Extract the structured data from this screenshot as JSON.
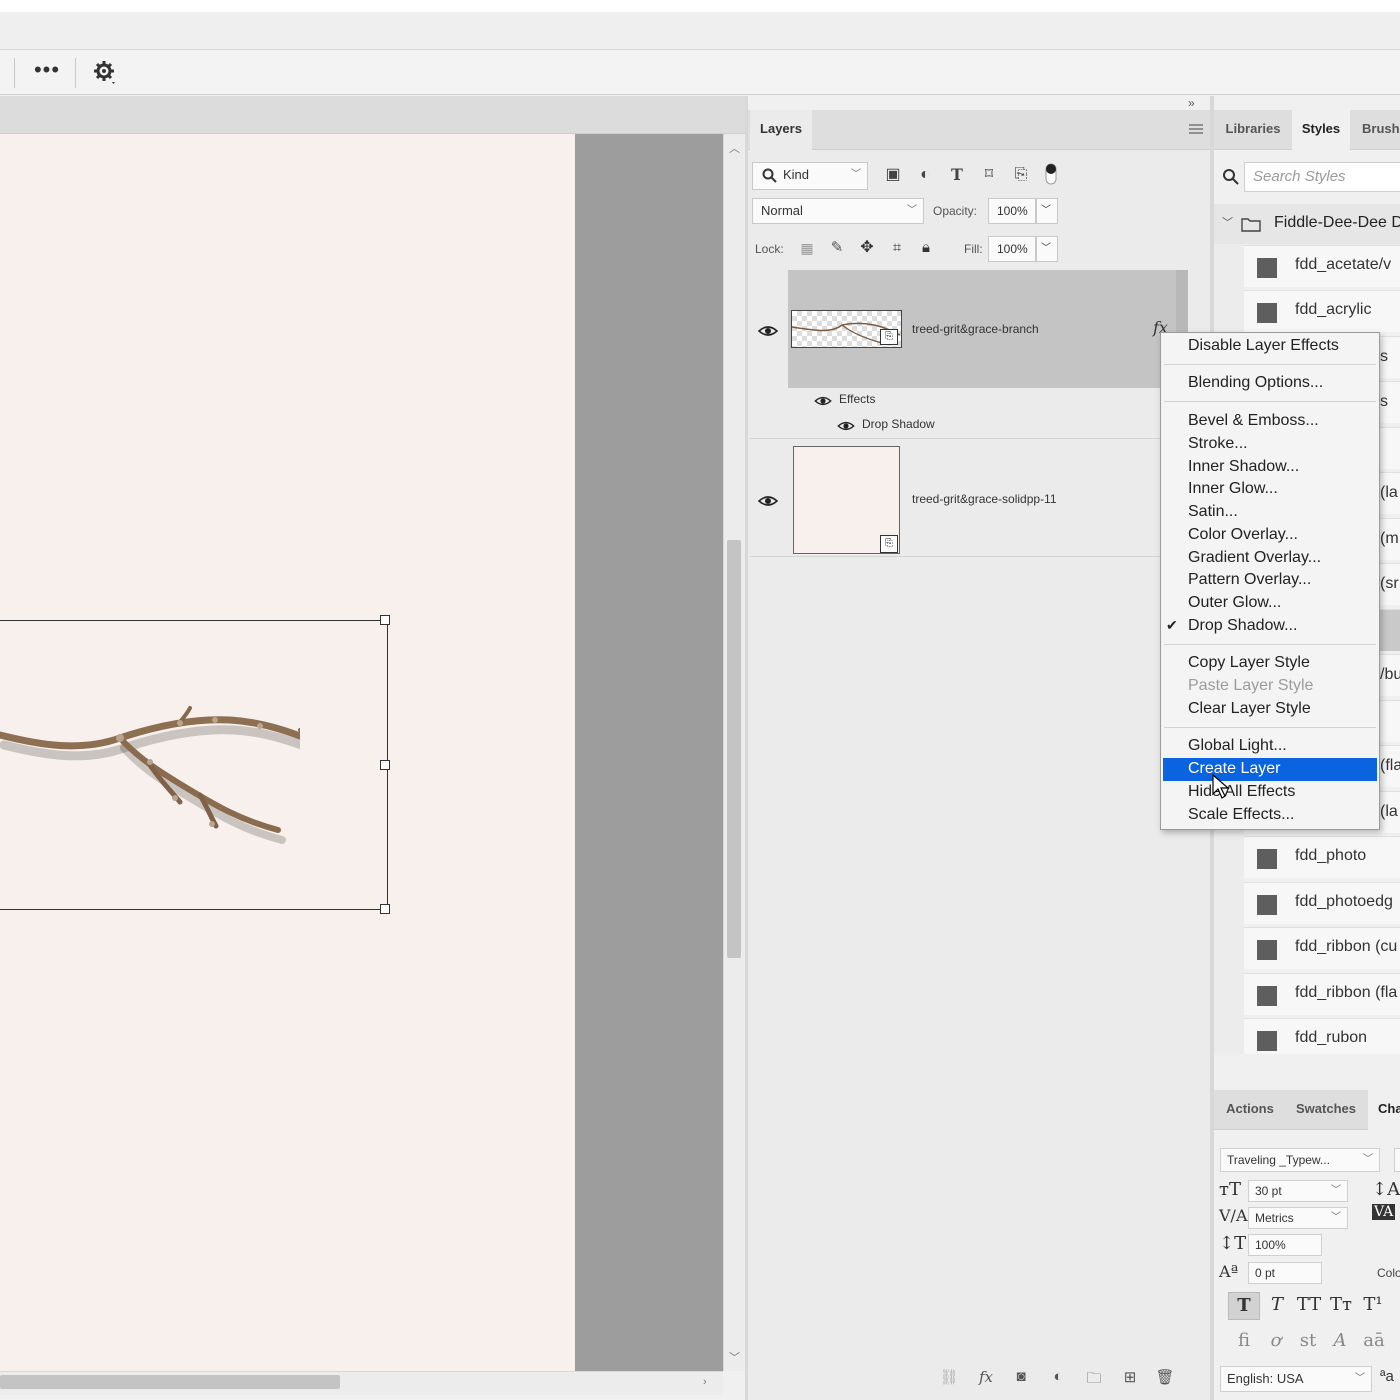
{
  "toolbar": {
    "more_label": "•••",
    "settings_icon": "gear-icon"
  },
  "layers_panel": {
    "tab_label": "Layers",
    "filter_kind": "Kind",
    "blend_mode": "Normal",
    "opacity_label": "Opacity:",
    "opacity_value": "100%",
    "lock_label": "Lock:",
    "fill_label": "Fill:",
    "fill_value": "100%",
    "layers": [
      {
        "name": "treed-grit&grace-branch",
        "fx_label": "fx",
        "effects_label": "Effects",
        "effect_items": [
          "Drop Shadow"
        ]
      },
      {
        "name": "treed-grit&grace-solidpp-11"
      }
    ]
  },
  "styles_panel": {
    "tabs": [
      "Libraries",
      "Styles",
      "Brush"
    ],
    "search_placeholder": "Search Styles",
    "group_name": "Fiddle-Dee-Dee D",
    "items": [
      "fdd_acetate/v",
      "fdd_acrylic",
      "fdd_photo",
      "fdd_photoedg",
      "fdd_ribbon (cu",
      "fdd_ribbon (fla",
      "fdd_rubon"
    ],
    "partial_fragments": [
      "s",
      "s",
      "(la",
      "(m",
      "(sr",
      "/bu",
      "(fla",
      "(la"
    ]
  },
  "context_menu": {
    "items": [
      {
        "label": "Disable Layer Effects"
      },
      {
        "label": "Blending Options..."
      },
      {
        "label": "Bevel & Emboss..."
      },
      {
        "label": "Stroke..."
      },
      {
        "label": "Inner Shadow..."
      },
      {
        "label": "Inner Glow..."
      },
      {
        "label": "Satin..."
      },
      {
        "label": "Color Overlay..."
      },
      {
        "label": "Gradient Overlay..."
      },
      {
        "label": "Pattern Overlay..."
      },
      {
        "label": "Outer Glow..."
      },
      {
        "label": "Drop Shadow...",
        "checked": true
      },
      {
        "label": "Copy Layer Style"
      },
      {
        "label": "Paste Layer Style",
        "disabled": true
      },
      {
        "label": "Clear Layer Style"
      },
      {
        "label": "Global Light..."
      },
      {
        "label": "Create Layer",
        "highlighted": true
      },
      {
        "label": "Hide All Effects"
      },
      {
        "label": "Scale Effects..."
      }
    ]
  },
  "bottom_panel": {
    "tabs": [
      "Actions",
      "Swatches",
      "Cha"
    ],
    "font_family": "Traveling _Typew...",
    "font_size": "30 pt",
    "kerning": "Metrics",
    "vertical_scale": "100%",
    "baseline_shift": "0 pt",
    "color_label": "Colo",
    "language": "English: USA",
    "aa_label": "ªa"
  },
  "colors": {
    "canvas": "#f7f0ec",
    "pasteboard": "#9d9d9d",
    "selected_layer": "#c4c4c4",
    "menu_highlight": "#0a64e0"
  }
}
